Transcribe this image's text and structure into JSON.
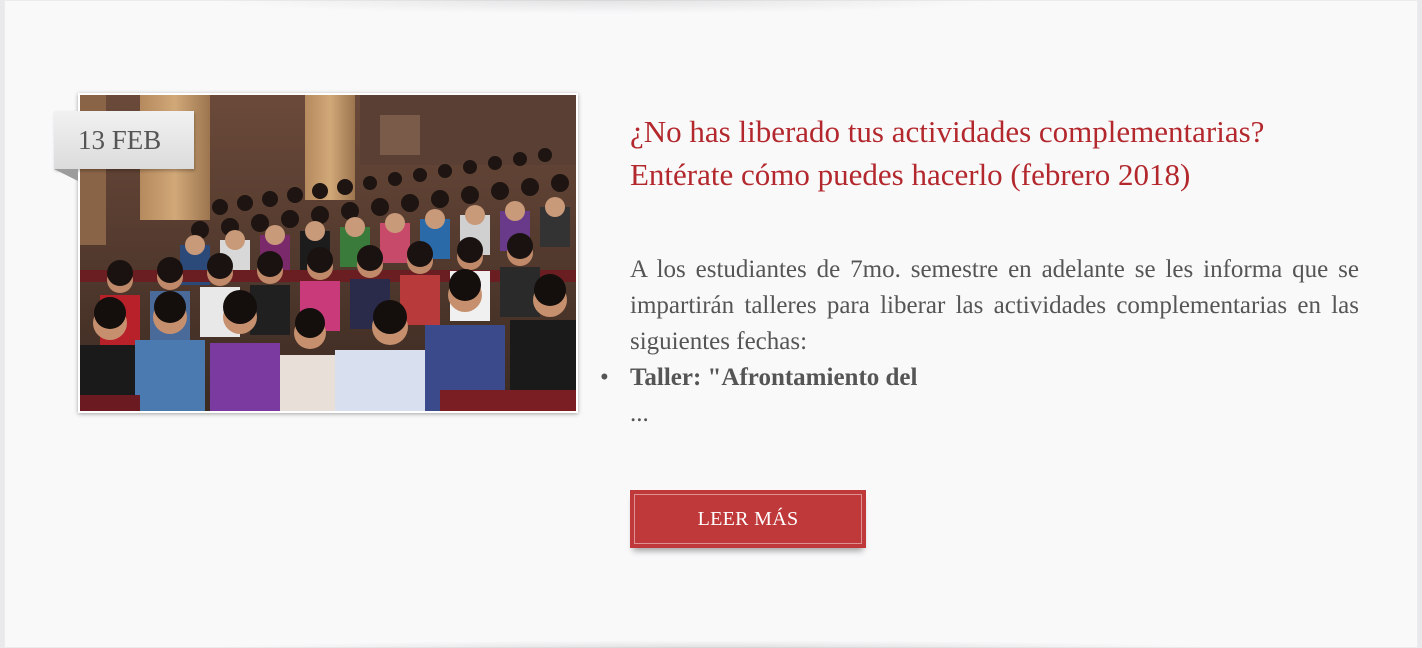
{
  "post": {
    "date": "13 FEB",
    "title": "¿No has liberado tus actividades complementarias? Entérate cómo puedes hacerlo (febrero 2018)",
    "excerpt": "A los estudiantes de 7mo. semestre en adelante se les informa que se impartirán talleres para liberar las actividades complementarias en las siguientes fechas:",
    "bullets": [
      "Taller: \"Afrontamiento del"
    ],
    "ellipsis": "...",
    "read_more_label": "LEER MÁS",
    "image": "photo of students seated in an auditorium"
  },
  "colors": {
    "title": "#b3282d",
    "button": "#c0393a",
    "body_text": "#555555",
    "background": "#f9f9fa"
  }
}
